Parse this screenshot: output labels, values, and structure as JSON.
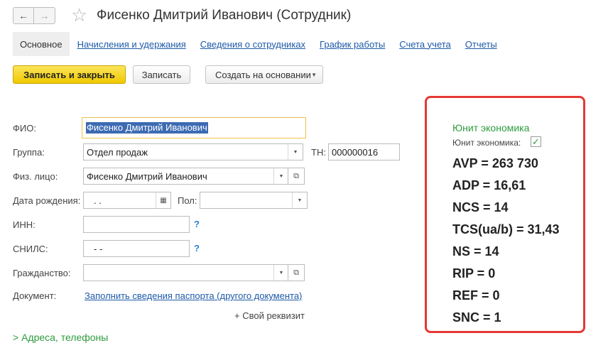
{
  "header": {
    "back_icon": "←",
    "forward_icon": "→",
    "star_icon": "☆",
    "title": "Фисенко Дмитрий Иванович (Сотрудник)"
  },
  "tabs": [
    {
      "label": "Основное"
    },
    {
      "label": "Начисления и удержания"
    },
    {
      "label": "Сведения о сотрудниках"
    },
    {
      "label": "График работы"
    },
    {
      "label": "Счета учета"
    },
    {
      "label": "Отчеты"
    }
  ],
  "toolbar": {
    "save_close_label": "Записать и закрыть",
    "save_label": "Записать",
    "create_based_label": "Создать на основании",
    "caret": "▼"
  },
  "form": {
    "fio_label": "ФИО:",
    "fio_value": "Фисенко Дмитрий Иванович",
    "group_label": "Группа:",
    "group_value": "Отдел продаж",
    "tn_label": "ТН:",
    "tn_value": "000000016",
    "person_label": "Физ. лицо:",
    "person_value": "Фисенко Дмитрий Иванович",
    "birth_label": "Дата рождения:",
    "birth_value": ".   .",
    "gender_label": "Пол:",
    "gender_value": "",
    "inn_label": "ИНН:",
    "inn_value": "",
    "snils_label": "СНИЛС:",
    "snils_value": "-   -",
    "citizenship_label": "Гражданство:",
    "citizenship_value": "",
    "document_label": "Документ:",
    "document_link": "Заполнить сведения паспорта (другого документа)",
    "help_mark": "?",
    "drop_arrow": "▼",
    "open_icon": "⧉",
    "calendar_icon": "▦",
    "add_requisite": "+ Свой реквизит"
  },
  "section": {
    "addresses_label": "> Адреса, телефоны"
  },
  "unit_panel": {
    "title": "Юнит экономика",
    "checkbox_label": "Юнит экономика:",
    "checkbox_checked": true,
    "check_mark": "✓",
    "metrics": [
      "AVP = 263 730",
      "ADP = 16,61",
      "NCS = 14",
      "TCS(ua/b) = 31,43",
      "NS = 14",
      "RIP = 0",
      "REF = 0",
      "SNC = 1"
    ],
    "border_color": "#e53935"
  }
}
